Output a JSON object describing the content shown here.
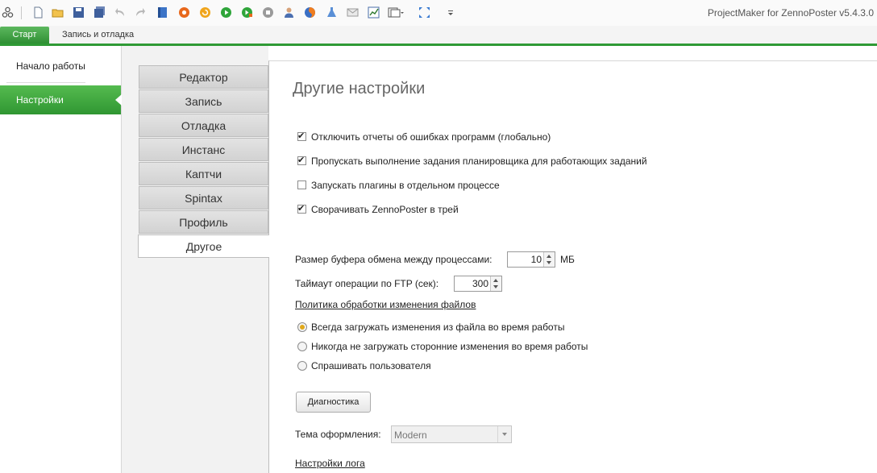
{
  "app": {
    "title": "ProjectMaker for ZennoPoster v5.4.3.0"
  },
  "toolbar": {
    "icons": [
      "cluster-icon",
      "new-file-icon",
      "open-folder-icon",
      "save-icon",
      "save-all-icon",
      "undo-icon",
      "redo-icon",
      "book-icon",
      "record-icon",
      "refresh-icon",
      "play-icon",
      "play-step-icon",
      "stop-icon",
      "user-icon",
      "firefox-icon",
      "flask-icon",
      "envelope-icon",
      "chart-icon",
      "windows-icon",
      "expand-icon",
      "overflow-icon"
    ]
  },
  "ribbon": {
    "tabs": [
      "Старт",
      "Запись и отладка"
    ]
  },
  "sidebar": {
    "items": [
      "Начало работы",
      "Настройки"
    ]
  },
  "settings_tabs": [
    "Редактор",
    "Запись",
    "Отладка",
    "Инстанс",
    "Каптчи",
    "Spintax",
    "Профиль",
    "Другое"
  ],
  "content": {
    "title": "Другие настройки",
    "checkboxes": [
      {
        "label": "Отключить отчеты об ошибках программ (глобально)",
        "checked": true
      },
      {
        "label": "Пропускать выполнение задания планировщика для работающих заданий",
        "checked": true
      },
      {
        "label": "Запускать плагины в отдельном процессе",
        "checked": false
      },
      {
        "label": "Сворачивать ZennoPoster в трей",
        "checked": true
      }
    ],
    "buffer": {
      "label": "Размер буфера обмена между процессами:",
      "value": "10",
      "unit": "МБ"
    },
    "ftp": {
      "label": "Таймаут операции по FTP (сек):",
      "value": "300"
    },
    "policy_link": "Политика обработки изменения файлов",
    "radios": [
      {
        "label": "Всегда загружать изменения из файла во время работы",
        "selected": true
      },
      {
        "label": "Никогда не загружать сторонние изменения во время работы",
        "selected": false
      },
      {
        "label": "Спрашивать пользователя",
        "selected": false
      }
    ],
    "diagnostics_button": "Диагностика",
    "theme": {
      "label": "Тема оформления:",
      "value": "Modern"
    },
    "log_link": "Настройки лога"
  },
  "colors": {
    "accent": "#2f9a35",
    "radio_selected": "#e0a81a"
  }
}
